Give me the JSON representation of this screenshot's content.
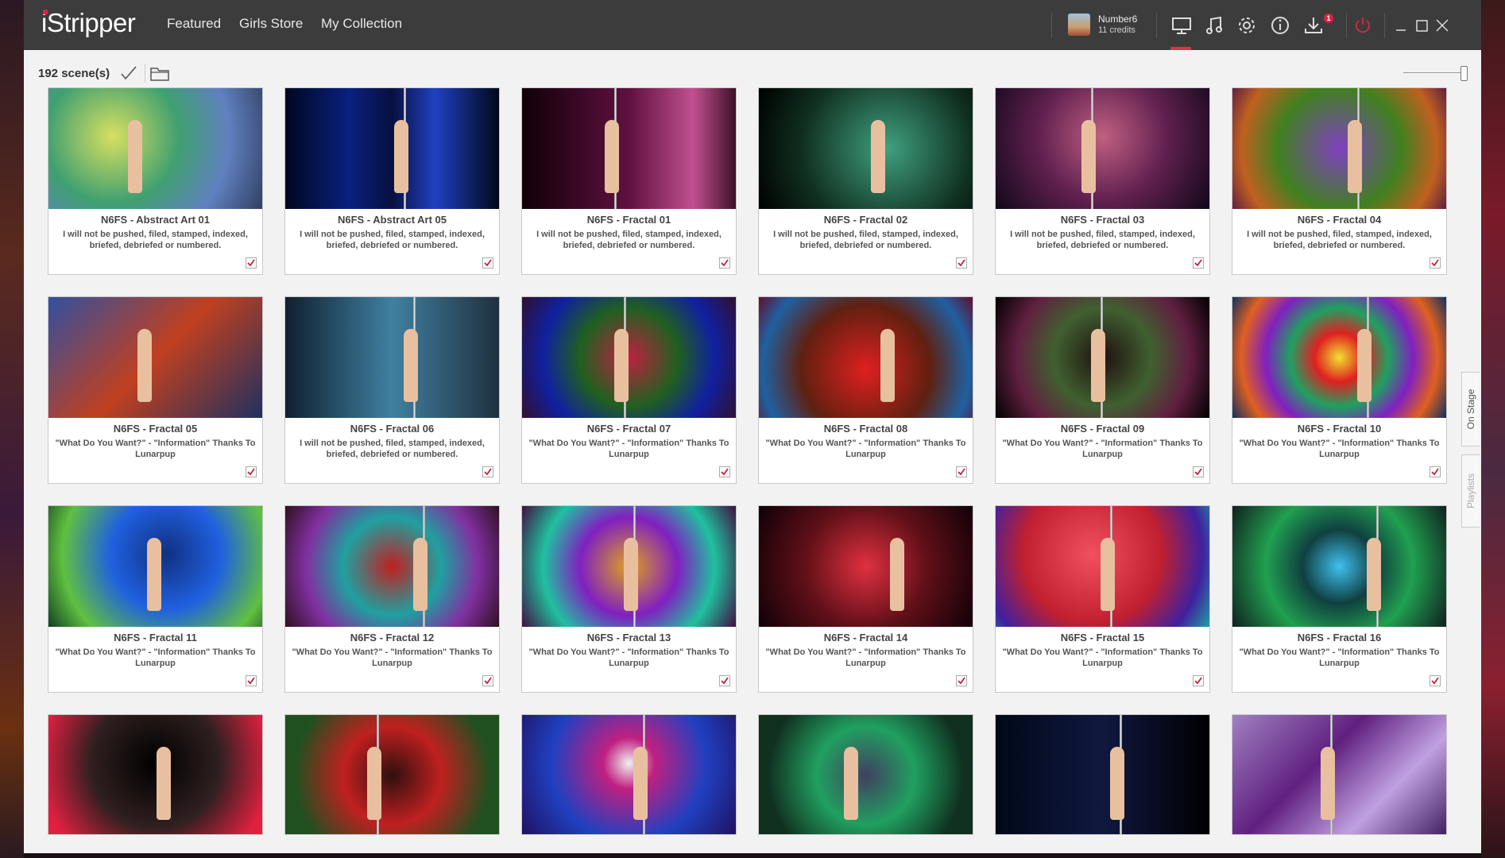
{
  "app": {
    "logo": "iStripper",
    "nav": [
      "Featured",
      "Girls Store",
      "My Collection"
    ],
    "profile": {
      "name": "Number6",
      "credits": "11 credits"
    },
    "download_badge": "1",
    "accent": "#e03048"
  },
  "toolbar": {
    "scene_count": "192 scene(s)"
  },
  "side_tabs": {
    "on_stage": "On Stage",
    "playlists": "Playlists"
  },
  "cards": [
    {
      "title": "N6FS - Abstract Art 01",
      "desc": "I will not be pushed, filed, stamped, indexed, briefed, debriefed or numbered."
    },
    {
      "title": "N6FS - Abstract Art 05",
      "desc": "I will not be pushed, filed, stamped, indexed, briefed, debriefed or numbered."
    },
    {
      "title": "N6FS - Fractal 01",
      "desc": "I will not be pushed, filed, stamped, indexed, briefed, debriefed or numbered."
    },
    {
      "title": "N6FS - Fractal 02",
      "desc": "I will not be pushed, filed, stamped, indexed, briefed, debriefed or numbered."
    },
    {
      "title": "N6FS - Fractal 03",
      "desc": "I will not be pushed, filed, stamped, indexed, briefed, debriefed or numbered."
    },
    {
      "title": "N6FS - Fractal 04",
      "desc": "I will not be pushed, filed, stamped, indexed, briefed, debriefed or numbered."
    },
    {
      "title": "N6FS - Fractal 05",
      "desc": "\"What Do You Want?\" - \"Information\" Thanks To Lunarpup"
    },
    {
      "title": "N6FS - Fractal 06",
      "desc": "I will not be pushed, filed, stamped, indexed, briefed, debriefed or numbered."
    },
    {
      "title": "N6FS - Fractal 07",
      "desc": "\"What Do You Want?\" - \"Information\" Thanks To Lunarpup"
    },
    {
      "title": "N6FS - Fractal 08",
      "desc": "\"What Do You Want?\" - \"Information\" Thanks To Lunarpup"
    },
    {
      "title": "N6FS - Fractal 09",
      "desc": "\"What Do You Want?\" - \"Information\" Thanks To Lunarpup"
    },
    {
      "title": "N6FS - Fractal 10",
      "desc": "\"What Do You Want?\" - \"Information\" Thanks To Lunarpup"
    },
    {
      "title": "N6FS - Fractal 11",
      "desc": "\"What Do You Want?\" - \"Information\" Thanks To Lunarpup"
    },
    {
      "title": "N6FS - Fractal 12",
      "desc": "\"What Do You Want?\" - \"Information\" Thanks To Lunarpup"
    },
    {
      "title": "N6FS - Fractal 13",
      "desc": "\"What Do You Want?\" - \"Information\" Thanks To Lunarpup"
    },
    {
      "title": "N6FS - Fractal 14",
      "desc": "\"What Do You Want?\" - \"Information\" Thanks To Lunarpup"
    },
    {
      "title": "N6FS - Fractal 15",
      "desc": "\"What Do You Want?\" - \"Information\" Thanks To Lunarpup"
    },
    {
      "title": "N6FS - Fractal 16",
      "desc": "\"What Do You Want?\" - \"Information\" Thanks To Lunarpup"
    }
  ]
}
